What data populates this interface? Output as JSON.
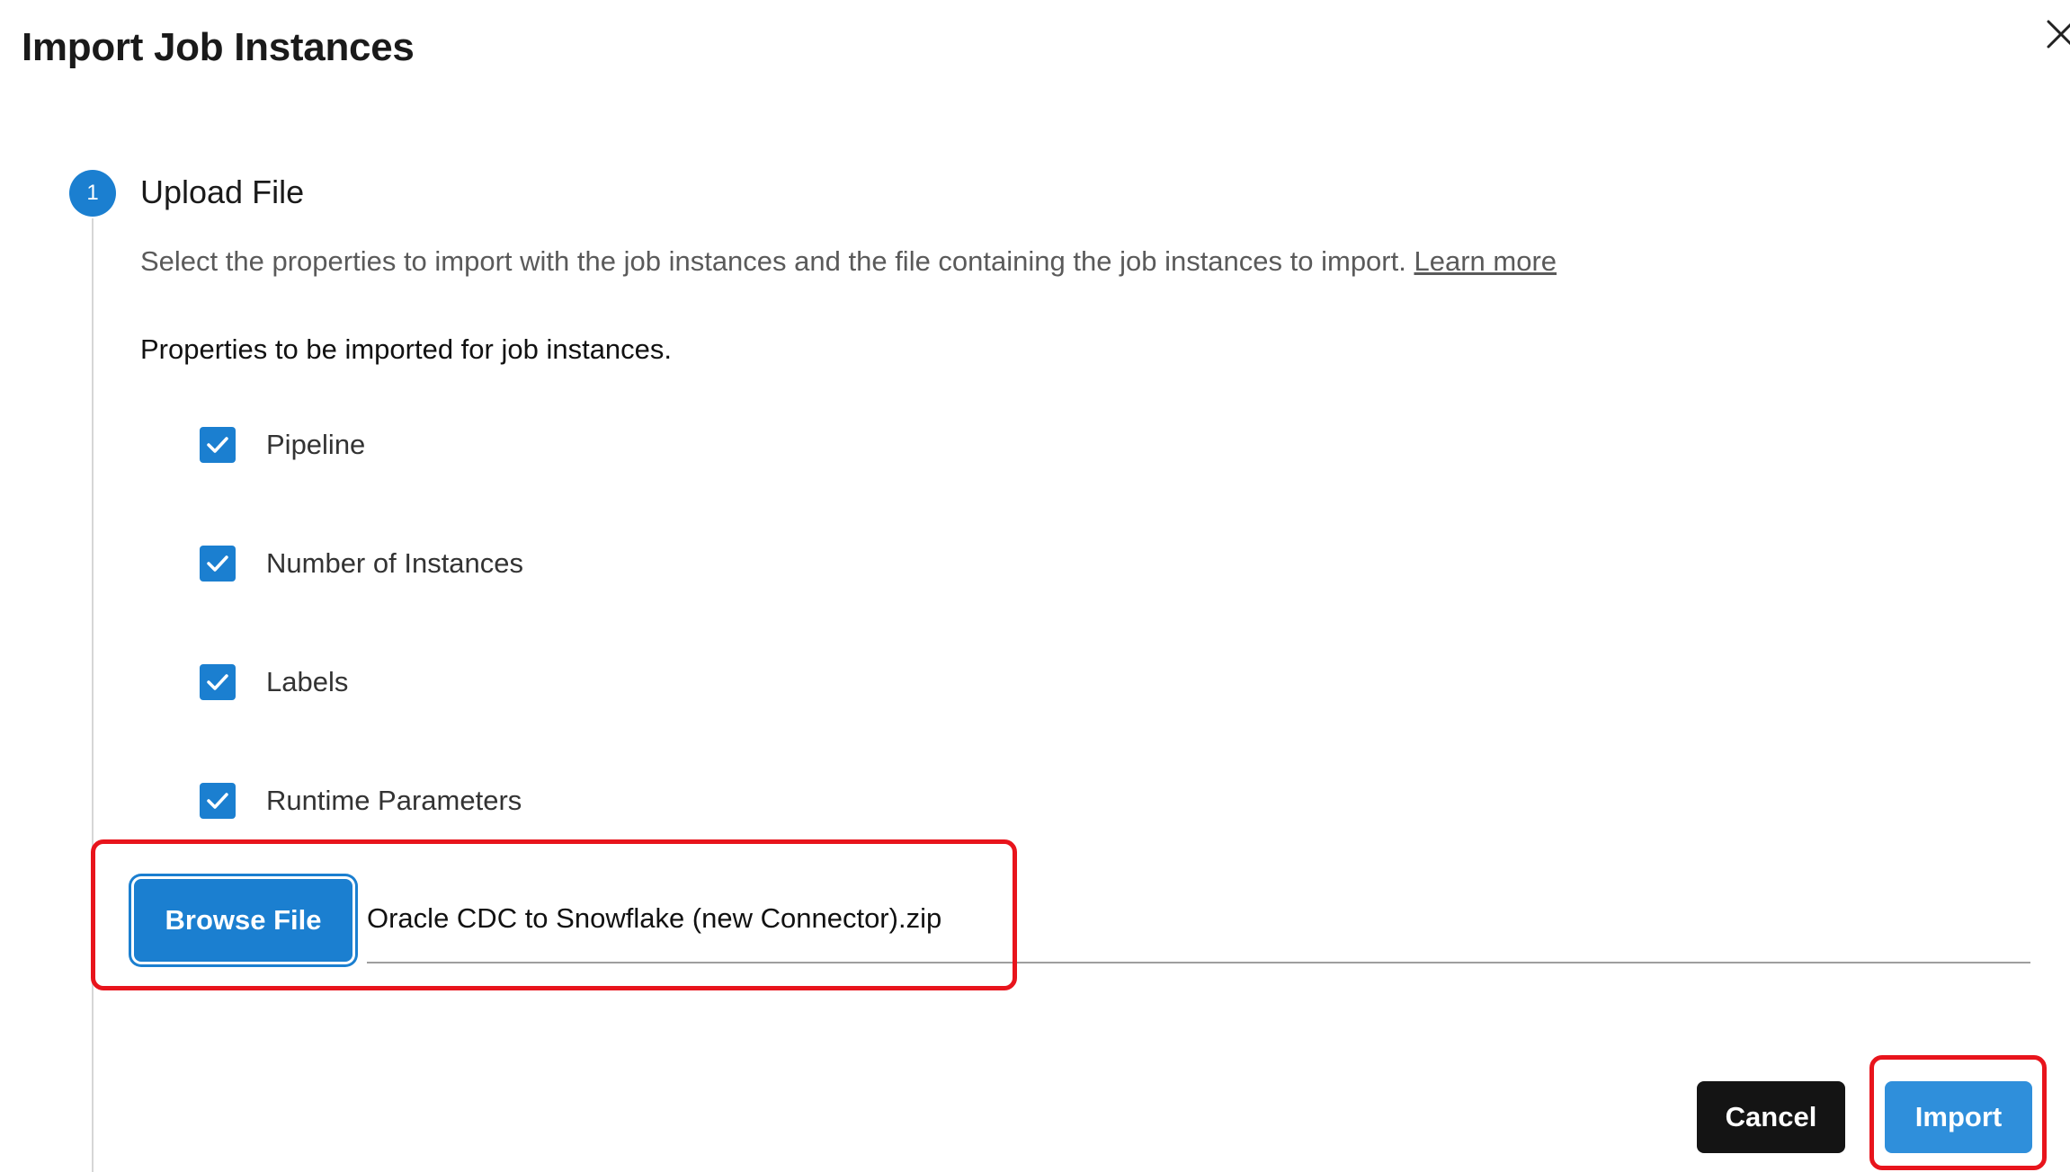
{
  "dialog": {
    "title": "Import Job Instances"
  },
  "step": {
    "number": "1",
    "title": "Upload File",
    "description": "Select the properties to import with the job instances and the file containing the job instances to import.",
    "learn_more_label": "Learn more"
  },
  "properties": {
    "heading": "Properties to be imported for job instances.",
    "items": [
      {
        "label": "Pipeline",
        "checked": true
      },
      {
        "label": "Number of Instances",
        "checked": true
      },
      {
        "label": "Labels",
        "checked": true
      },
      {
        "label": "Runtime Parameters",
        "checked": true
      }
    ]
  },
  "file": {
    "browse_label": "Browse File",
    "selected_name": "Oracle CDC to Snowflake (new Connector).zip"
  },
  "footer": {
    "cancel_label": "Cancel",
    "import_label": "Import"
  },
  "colors": {
    "accent": "#1b7fd0",
    "import_button": "#2f8fdb",
    "cancel_button": "#141414",
    "highlight": "#e8141c"
  },
  "icons": {
    "close": "close-icon",
    "checkbox": "checkmark-icon"
  }
}
